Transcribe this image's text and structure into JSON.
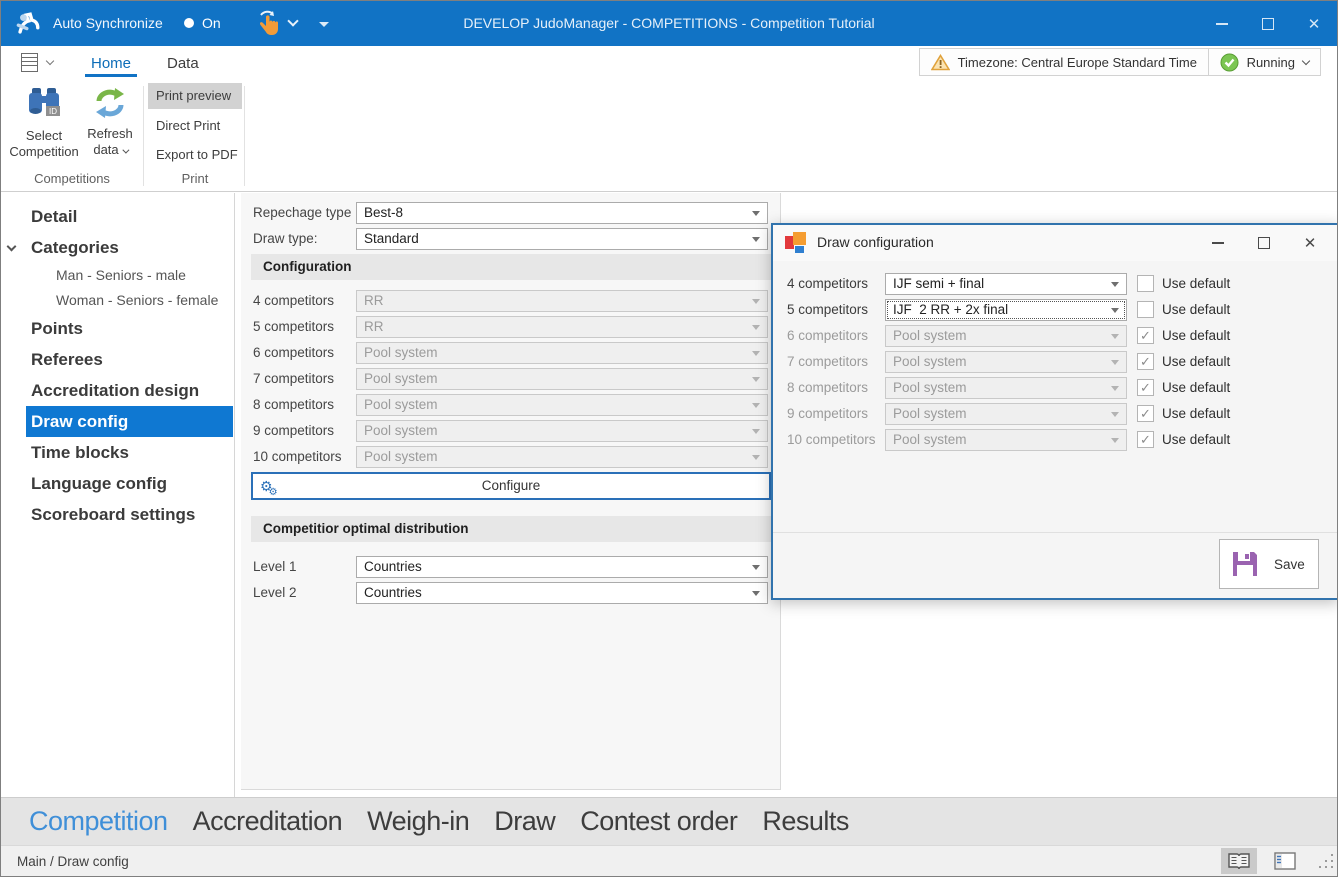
{
  "titlebar": {
    "app_label": "Auto Synchronize",
    "sync_state": "On",
    "title": "DEVELOP JudoManager - COMPETITIONS - Competition Tutorial"
  },
  "ribbon": {
    "tabs": [
      {
        "label": "Home",
        "active": true
      },
      {
        "label": "Data",
        "active": false
      }
    ],
    "competitions_group": {
      "label": "Competitions",
      "select_competition_label": "Select Competition",
      "refresh_data_label": "Refresh data"
    },
    "print_group": {
      "label": "Print",
      "items": [
        {
          "label": "Print preview",
          "highlighted": true
        },
        {
          "label": "Direct Print",
          "highlighted": false
        },
        {
          "label": "Export to PDF",
          "highlighted": false
        }
      ]
    },
    "timezone_badge": "Timezone: Central Europe Standard Time",
    "running_badge": "Running"
  },
  "sidebar": {
    "items": [
      {
        "label": "Detail",
        "selected": false
      },
      {
        "label": "Categories",
        "selected": false,
        "expanded": true
      },
      {
        "label": "Man - Seniors - male",
        "child": true
      },
      {
        "label": "Woman - Seniors - female",
        "child": true
      },
      {
        "label": "Points",
        "selected": false
      },
      {
        "label": "Referees",
        "selected": false
      },
      {
        "label": "Accreditation design",
        "selected": false
      },
      {
        "label": "Draw config",
        "selected": true
      },
      {
        "label": "Time blocks",
        "selected": false
      },
      {
        "label": "Language config",
        "selected": false
      },
      {
        "label": "Scoreboard settings",
        "selected": false
      }
    ]
  },
  "form": {
    "repechage": {
      "label": "Repechage type",
      "value": "Best-8"
    },
    "draw_type": {
      "label": "Draw type:",
      "value": "Standard"
    },
    "configuration_header": "Configuration",
    "rows": [
      {
        "label": "4 competitors",
        "value": "RR",
        "disabled": true
      },
      {
        "label": "5 competitors",
        "value": "RR",
        "disabled": true
      },
      {
        "label": "6 competitors",
        "value": "Pool system",
        "disabled": true
      },
      {
        "label": "7 competitors",
        "value": "Pool system",
        "disabled": true
      },
      {
        "label": "8 competitors",
        "value": "Pool system",
        "disabled": true
      },
      {
        "label": "9 competitors",
        "value": "Pool system",
        "disabled": true
      },
      {
        "label": "10 competitors",
        "value": "Pool system",
        "disabled": true
      }
    ],
    "configure_button": "Configure",
    "distribution_header": "Competitior optimal distribution",
    "level1": {
      "label": "Level 1",
      "value": "Countries"
    },
    "level2": {
      "label": "Level 2",
      "value": "Countries"
    }
  },
  "dialog": {
    "title": "Draw configuration",
    "use_default_label": "Use default",
    "rows": [
      {
        "label": "4 competitors",
        "value": "IJF semi + final",
        "use_default": false,
        "disabled": false,
        "focused": false
      },
      {
        "label": "5 competitors",
        "value": "IJF  2 RR + 2x final",
        "use_default": false,
        "disabled": false,
        "focused": true
      },
      {
        "label": "6 competitors",
        "value": "Pool system",
        "use_default": true,
        "disabled": true,
        "focused": false
      },
      {
        "label": "7 competitors",
        "value": "Pool system",
        "use_default": true,
        "disabled": true,
        "focused": false
      },
      {
        "label": "8 competitors",
        "value": "Pool system",
        "use_default": true,
        "disabled": true,
        "focused": false
      },
      {
        "label": "9 competitors",
        "value": "Pool system",
        "use_default": true,
        "disabled": true,
        "focused": false
      },
      {
        "label": "10 competitors",
        "value": "Pool system",
        "use_default": true,
        "disabled": true,
        "focused": false
      }
    ],
    "save_button": "Save"
  },
  "bottom_nav": {
    "items": [
      {
        "label": "Competition",
        "active": true
      },
      {
        "label": "Accreditation",
        "active": false
      },
      {
        "label": "Weigh-in",
        "active": false
      },
      {
        "label": "Draw",
        "active": false
      },
      {
        "label": "Contest order",
        "active": false
      },
      {
        "label": "Results",
        "active": false
      }
    ]
  },
  "statusbar": {
    "breadcrumb": "Main / Draw config"
  },
  "colors": {
    "titlebar_blue": "#1173c5",
    "accent_blue": "#0f78d2",
    "warning_orange": "#e0a23c",
    "running_green": "#7cc653",
    "save_purple": "#9a63b0"
  }
}
